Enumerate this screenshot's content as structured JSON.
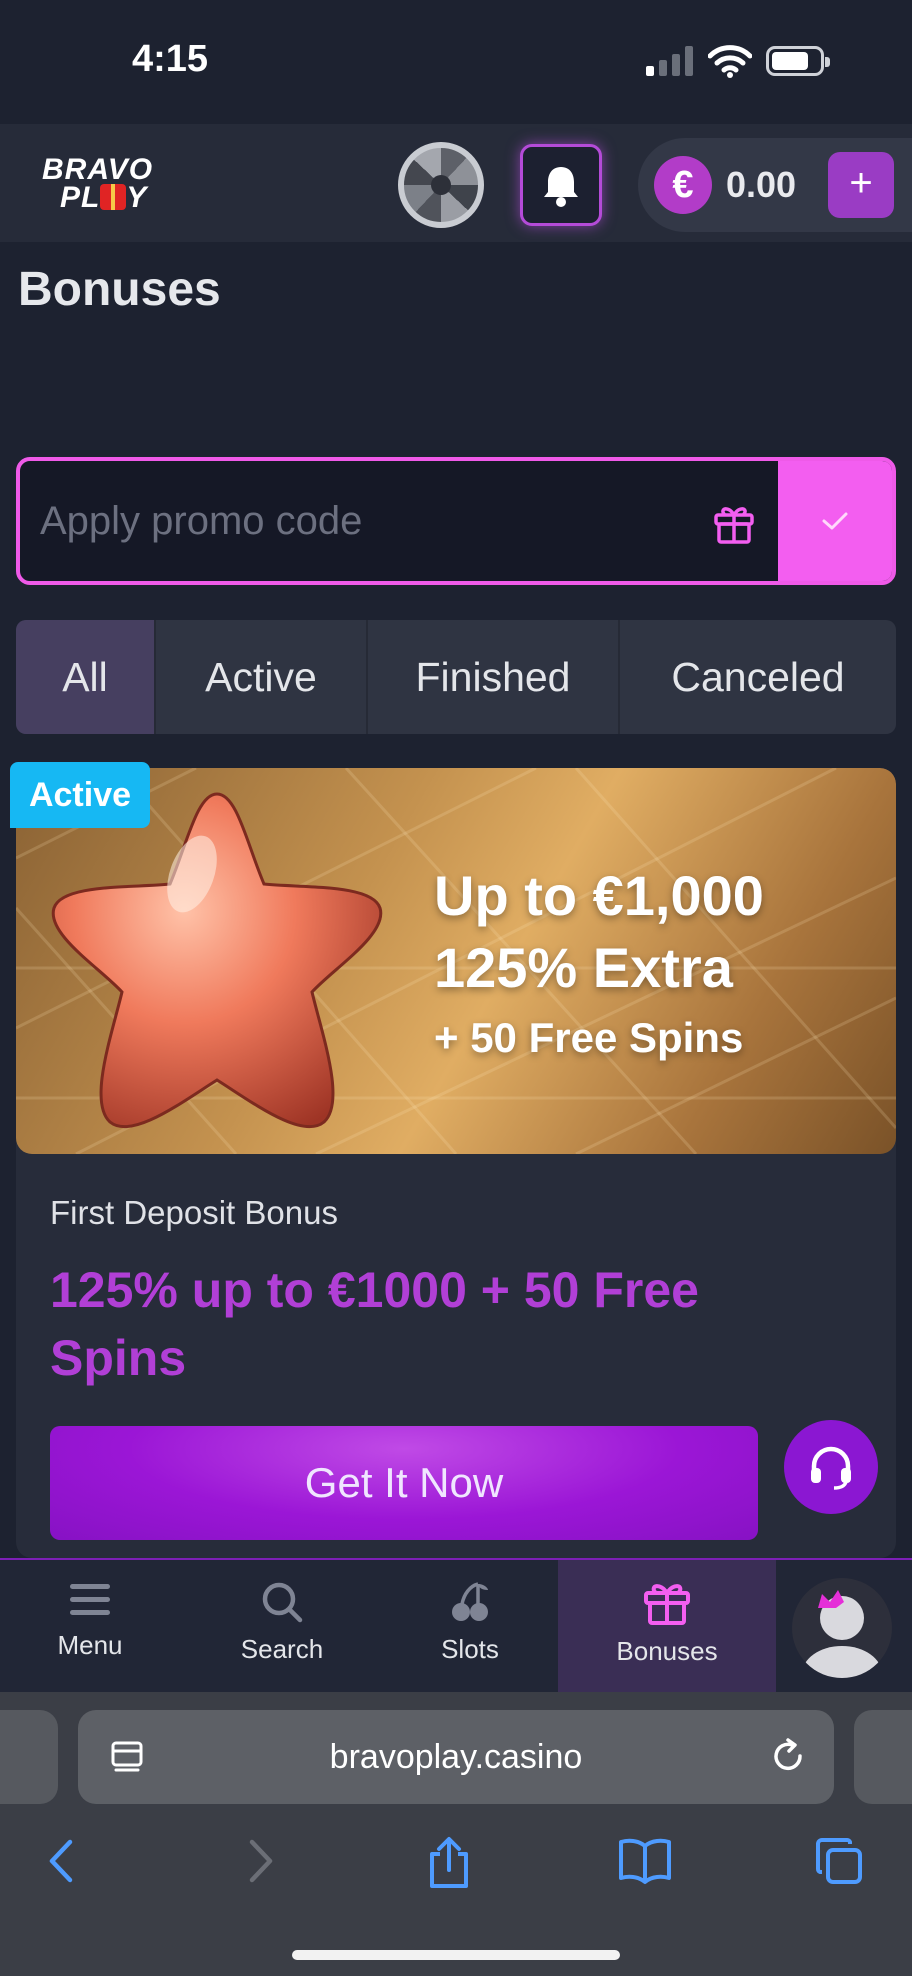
{
  "status_bar": {
    "time": "4:15"
  },
  "header": {
    "logo_line1": "BRAVO",
    "logo_line2": "PL",
    "logo_line2_end": "Y",
    "currency_symbol": "€",
    "balance": "0.00",
    "add_funds_label": "+"
  },
  "page": {
    "title": "Bonuses"
  },
  "promo": {
    "placeholder": "Apply promo code",
    "apply_icon": "check-icon"
  },
  "tabs": [
    {
      "label": "All",
      "selected": true
    },
    {
      "label": "Active",
      "selected": false
    },
    {
      "label": "Finished",
      "selected": false
    },
    {
      "label": "Canceled",
      "selected": false
    }
  ],
  "bonus_card": {
    "status": "Active",
    "banner_line1": "Up to €1,000",
    "banner_line2": "125% Extra",
    "banner_line3": "+ 50 Free Spins",
    "type": "First Deposit Bonus",
    "offer": "125% up to €1000 + 50 Free Spins",
    "cta_label": "Get It Now"
  },
  "bottom_nav": [
    {
      "label": "Menu",
      "icon": "menu-icon"
    },
    {
      "label": "Search",
      "icon": "search-icon"
    },
    {
      "label": "Slots",
      "icon": "cherries-icon"
    },
    {
      "label": "Bonuses",
      "icon": "gift-icon",
      "active": true
    }
  ],
  "browser": {
    "url": "bravoplay.casino"
  },
  "colors": {
    "accent_pink": "#f35ef0",
    "accent_purple": "#9b16d6",
    "offer_text": "#b13fd6",
    "active_badge": "#16b8f3",
    "background": "#1d2230"
  }
}
